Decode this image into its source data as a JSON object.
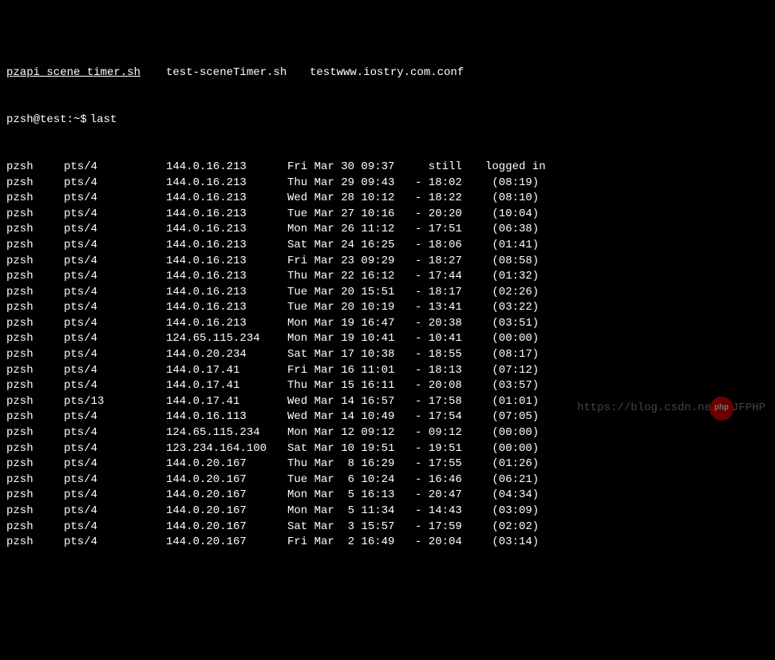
{
  "files": [
    "pzapi_scene_timer.sh",
    "test-sceneTimer.sh",
    "testwww.iostry.com.conf"
  ],
  "prompt": "pzsh@test:~$",
  "command": "last",
  "rows": [
    {
      "user": "pzsh",
      "tty": "pts/4",
      "host": "144.0.16.213",
      "login": "Fri Mar 30 09:37",
      "logout": "  still",
      "duration": "logged in"
    },
    {
      "user": "pzsh",
      "tty": "pts/4",
      "host": "144.0.16.213",
      "login": "Thu Mar 29 09:43",
      "logout": "- 18:02",
      "duration": " (08:19)"
    },
    {
      "user": "pzsh",
      "tty": "pts/4",
      "host": "144.0.16.213",
      "login": "Wed Mar 28 10:12",
      "logout": "- 18:22",
      "duration": " (08:10)"
    },
    {
      "user": "pzsh",
      "tty": "pts/4",
      "host": "144.0.16.213",
      "login": "Tue Mar 27 10:16",
      "logout": "- 20:20",
      "duration": " (10:04)"
    },
    {
      "user": "pzsh",
      "tty": "pts/4",
      "host": "144.0.16.213",
      "login": "Mon Mar 26 11:12",
      "logout": "- 17:51",
      "duration": " (06:38)"
    },
    {
      "user": "pzsh",
      "tty": "pts/4",
      "host": "144.0.16.213",
      "login": "Sat Mar 24 16:25",
      "logout": "- 18:06",
      "duration": " (01:41)"
    },
    {
      "user": "pzsh",
      "tty": "pts/4",
      "host": "144.0.16.213",
      "login": "Fri Mar 23 09:29",
      "logout": "- 18:27",
      "duration": " (08:58)"
    },
    {
      "user": "pzsh",
      "tty": "pts/4",
      "host": "144.0.16.213",
      "login": "Thu Mar 22 16:12",
      "logout": "- 17:44",
      "duration": " (01:32)"
    },
    {
      "user": "pzsh",
      "tty": "pts/4",
      "host": "144.0.16.213",
      "login": "Tue Mar 20 15:51",
      "logout": "- 18:17",
      "duration": " (02:26)"
    },
    {
      "user": "pzsh",
      "tty": "pts/4",
      "host": "144.0.16.213",
      "login": "Tue Mar 20 10:19",
      "logout": "- 13:41",
      "duration": " (03:22)"
    },
    {
      "user": "pzsh",
      "tty": "pts/4",
      "host": "144.0.16.213",
      "login": "Mon Mar 19 16:47",
      "logout": "- 20:38",
      "duration": " (03:51)"
    },
    {
      "user": "pzsh",
      "tty": "pts/4",
      "host": "124.65.115.234",
      "login": "Mon Mar 19 10:41",
      "logout": "- 10:41",
      "duration": " (00:00)"
    },
    {
      "user": "pzsh",
      "tty": "pts/4",
      "host": "144.0.20.234",
      "login": "Sat Mar 17 10:38",
      "logout": "- 18:55",
      "duration": " (08:17)"
    },
    {
      "user": "pzsh",
      "tty": "pts/4",
      "host": "144.0.17.41",
      "login": "Fri Mar 16 11:01",
      "logout": "- 18:13",
      "duration": " (07:12)"
    },
    {
      "user": "pzsh",
      "tty": "pts/4",
      "host": "144.0.17.41",
      "login": "Thu Mar 15 16:11",
      "logout": "- 20:08",
      "duration": " (03:57)"
    },
    {
      "user": "pzsh",
      "tty": "pts/13",
      "host": "144.0.17.41",
      "login": "Wed Mar 14 16:57",
      "logout": "- 17:58",
      "duration": " (01:01)"
    },
    {
      "user": "pzsh",
      "tty": "pts/4",
      "host": "144.0.16.113",
      "login": "Wed Mar 14 10:49",
      "logout": "- 17:54",
      "duration": " (07:05)"
    },
    {
      "user": "pzsh",
      "tty": "pts/4",
      "host": "124.65.115.234",
      "login": "Mon Mar 12 09:12",
      "logout": "- 09:12",
      "duration": " (00:00)"
    },
    {
      "user": "pzsh",
      "tty": "pts/4",
      "host": "123.234.164.100",
      "login": "Sat Mar 10 19:51",
      "logout": "- 19:51",
      "duration": " (00:00)"
    },
    {
      "user": "pzsh",
      "tty": "pts/4",
      "host": "144.0.20.167",
      "login": "Thu Mar  8 16:29",
      "logout": "- 17:55",
      "duration": " (01:26)"
    },
    {
      "user": "pzsh",
      "tty": "pts/4",
      "host": "144.0.20.167",
      "login": "Tue Mar  6 10:24",
      "logout": "- 16:46",
      "duration": " (06:21)"
    },
    {
      "user": "pzsh",
      "tty": "pts/4",
      "host": "144.0.20.167",
      "login": "Mon Mar  5 16:13",
      "logout": "- 20:47",
      "duration": " (04:34)"
    },
    {
      "user": "pzsh",
      "tty": "pts/4",
      "host": "144.0.20.167",
      "login": "Mon Mar  5 11:34",
      "logout": "- 14:43",
      "duration": " (03:09)"
    },
    {
      "user": "pzsh",
      "tty": "pts/4",
      "host": "144.0.20.167",
      "login": "Sat Mar  3 15:57",
      "logout": "- 17:59",
      "duration": " (02:02)"
    },
    {
      "user": "pzsh",
      "tty": "pts/4",
      "host": "144.0.20.167",
      "login": "Fri Mar  2 16:49",
      "logout": "- 20:04",
      "duration": " (03:14)"
    }
  ],
  "watermark": {
    "prefix": "https://blog.csdn.ne",
    "badge": "php",
    "suffix": "JFPHP"
  }
}
